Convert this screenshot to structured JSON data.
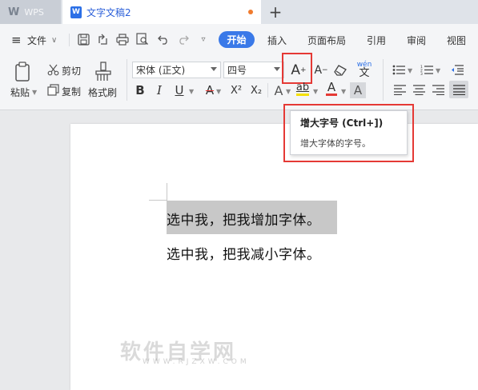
{
  "tabs": {
    "app_logo": "W",
    "app_name": "WPS",
    "doc_icon": "W",
    "doc_title": "文字文稿2",
    "new_tab": "+"
  },
  "menu": {
    "hamburger": "≡",
    "file": "文件",
    "items": [
      "开始",
      "插入",
      "页面布局",
      "引用",
      "审阅",
      "视图"
    ]
  },
  "ribbon": {
    "paste": "粘贴",
    "cut": "剪切",
    "copy": "复制",
    "format_painter": "格式刷",
    "font_name": "宋体 (正文)",
    "font_size": "四号",
    "grow_font_glyph": "A",
    "shrink_font_glyph": "A",
    "phonetic_glyph": "wén",
    "bold": "B",
    "italic": "I",
    "underline": "U",
    "strike": "A",
    "superscript": "X²",
    "subscript": "X₂",
    "text_effect": "A",
    "highlight": "ab",
    "font_color": "A",
    "char_shading": "A"
  },
  "tooltip": {
    "title": "增大字号 (Ctrl+])",
    "description": "增大字体的字号。"
  },
  "document": {
    "line1": "选中我，把我增加字体。",
    "line2": "选中我，把我减小字体。"
  },
  "watermark": {
    "main": "软件自学网",
    "sub": "WWW.RJZXW.COM"
  },
  "colors": {
    "accent": "#3a79e8",
    "highlight_box": "#e53935",
    "selection": "#c8c8c8",
    "font_color_bar": "#e53935",
    "highlight_bar": "#f5e000"
  }
}
